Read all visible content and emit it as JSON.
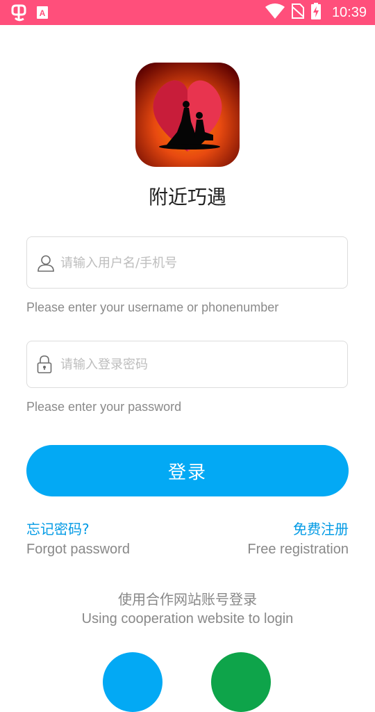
{
  "status_bar": {
    "time": "10:39",
    "icons": [
      "app-bug-icon",
      "a-notification-icon",
      "wifi-icon",
      "no-sim-icon",
      "battery-charging-icon"
    ],
    "background": "#ff4f7b"
  },
  "app": {
    "title": "附近巧遇",
    "logo_icon": "couple-heart-logo"
  },
  "username": {
    "placeholder": "请输入用户名/手机号",
    "value": "",
    "hint": "Please enter your username or phonenumber",
    "icon": "user-icon"
  },
  "password": {
    "placeholder": "请输入登录密码",
    "value": "",
    "hint": "Please enter your password",
    "icon": "lock-icon"
  },
  "login_button": {
    "label": "登录",
    "color": "#03a9f4"
  },
  "links": {
    "forgot_cn": "忘记密码?",
    "forgot_en": "Forgot password",
    "register_cn": "免费注册",
    "register_en": "Free registration",
    "color": "#039be5"
  },
  "cooperation": {
    "text_cn": "使用合作网站账号登录",
    "text_en": "Using cooperation website to login",
    "providers": [
      {
        "icon": "blue-circle-login-icon",
        "color": "#03a9f4"
      },
      {
        "icon": "green-circle-login-icon",
        "color": "#0ea44a"
      }
    ]
  }
}
